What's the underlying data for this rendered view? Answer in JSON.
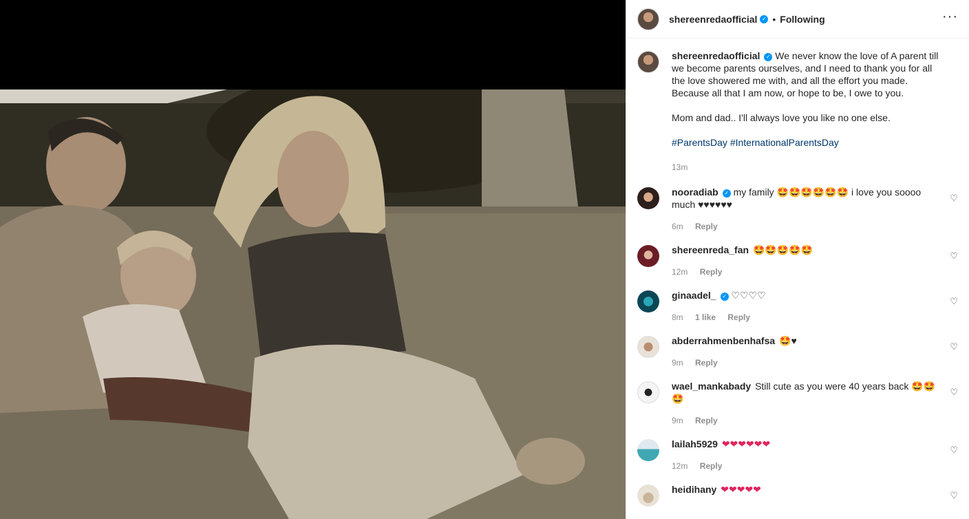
{
  "post": {
    "owner": {
      "username": "shereenredaofficial",
      "verified": true
    },
    "follow_status": "Following",
    "separator": "•",
    "more_icon": "more-horizontal-icon",
    "caption": {
      "line1": "We never know the love of A parent till we become parents ourselves, and I need to thank you for all the love showered me with, and all the effort you made. Because all that I am now, or hope to be, I owe to you.",
      "line2": "Mom and dad.. I'll always love you like no one else.",
      "hashtags": "#ParentsDay #InternationalParentsDay",
      "time": "13m"
    }
  },
  "comments": [
    {
      "username": "nooradiab",
      "verified": true,
      "text": "my family 🤩🤩🤩🤩🤩🤩 i love you soooo much ♥♥♥♥♥♥",
      "time": "6m",
      "likes": "",
      "reply": "Reply"
    },
    {
      "username": "shereenreda_fan",
      "verified": false,
      "text": "🤩🤩🤩🤩🤩",
      "time": "12m",
      "likes": "",
      "reply": "Reply"
    },
    {
      "username": "ginaadel_",
      "verified": true,
      "text": "♡♡♡♡",
      "time": "8m",
      "likes": "1 like",
      "reply": "Reply"
    },
    {
      "username": "abderrahmenbenhafsa",
      "verified": false,
      "text": "🤩♥",
      "time": "9m",
      "likes": "",
      "reply": "Reply"
    },
    {
      "username": "wael_mankabady",
      "verified": false,
      "text": "Still cute as you were 40 years back 🤩🤩🤩",
      "time": "9m",
      "likes": "",
      "reply": "Reply"
    },
    {
      "username": "lailah5929",
      "verified": false,
      "text": "❤❤❤❤❤❤",
      "time": "12m",
      "likes": "",
      "reply": "Reply"
    },
    {
      "username": "heidihany",
      "verified": false,
      "text": "❤❤❤❤❤",
      "time": "",
      "likes": "",
      "reply": ""
    }
  ],
  "colors": {
    "link": "#00376b",
    "verified": "#0095f6",
    "meta": "#8e8e8e"
  }
}
